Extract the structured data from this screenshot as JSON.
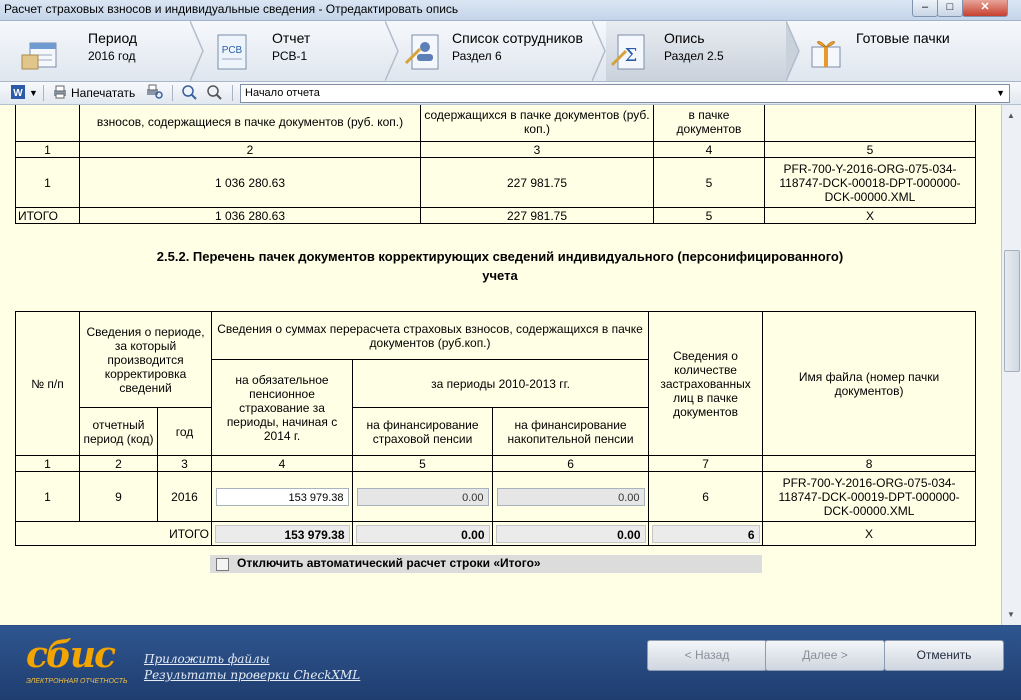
{
  "window": {
    "title": "Расчет страховых взносов и индивидуальные сведения - Отредактировать опись",
    "minimize": "–",
    "maximize": "□",
    "close": "✕"
  },
  "steps": [
    {
      "name": "Период",
      "sub": "2016 год"
    },
    {
      "name": "Отчет",
      "sub": "РСВ-1",
      "icon_text": "РСВ"
    },
    {
      "name": "Список сотрудников",
      "sub": "Раздел 6"
    },
    {
      "name": "Опись",
      "sub": "Раздел 2.5"
    },
    {
      "name": "Готовые пачки",
      "sub": ""
    }
  ],
  "toolbar": {
    "print_label": "Напечатать",
    "section_select": "Начало отчета"
  },
  "table1": {
    "header": {
      "col2": "взносов, содержащиеся в пачке документов (руб. коп.)",
      "col3": "содержащихся в пачке документов (руб. коп.)",
      "col4": "в пачке документов",
      "col5": ""
    },
    "nums": [
      "1",
      "2",
      "3",
      "4",
      "5"
    ],
    "row": {
      "n": "1",
      "c2": "1 036 280.63",
      "c3": "227 981.75",
      "c4": "5",
      "c5": "PFR-700-Y-2016-ORG-075-034-118747-DCK-00018-DPT-000000-DCK-00000.XML"
    },
    "total": {
      "label": "ИТОГО",
      "c2": "1 036 280.63",
      "c3": "227 981.75",
      "c4": "5",
      "c5": "Х"
    }
  },
  "section_title": "2.5.2. Перечень пачек документов корректирующих сведений индивидуального (персонифицированного) учета",
  "table2": {
    "headers": {
      "num": "№ п/п",
      "period": "Сведения о периоде, за который производится корректировка сведений",
      "sums": "Сведения о суммах перерасчета страховых взносов, содержащихся в пачке документов (руб.коп.)",
      "insured": "Сведения о количестве застрахованных лиц в пачке документов",
      "file": "Имя файла (номер пачки документов)",
      "mandatory": "на обязательное пенсионное страхование за периоды, начиная с 2014 г.",
      "periods": "за периоды 2010-2013 гг.",
      "report_period": "отчетный период (код)",
      "year": "год",
      "insurance": "на финансирование страховой пенсии",
      "funded": "на финансирование накопительной пенсии"
    },
    "nums": [
      "1",
      "2",
      "3",
      "4",
      "5",
      "6",
      "7",
      "8"
    ],
    "row": {
      "n": "1",
      "period": "9",
      "year": "2016",
      "c4": "153 979.38",
      "c5": "0.00",
      "c6": "0.00",
      "c7": "6",
      "c8": "PFR-700-Y-2016-ORG-075-034-118747-DCK-00019-DPT-000000-DCK-00000.XML"
    },
    "total": {
      "label": "ИТОГО",
      "c4": "153 979.38",
      "c5": "0.00",
      "c6": "0.00",
      "c7": "6",
      "c8": "Х"
    }
  },
  "option": {
    "label": "Отключить автоматический расчет строки «Итого»",
    "checked": false
  },
  "footer": {
    "logo": "сбис",
    "logo_tagline": "ЭЛЕКТРОННАЯ ОТЧЕТНОСТЬ",
    "link1": "Приложить файлы",
    "link2": "Результаты проверки CheckXML",
    "back": "< Назад",
    "next": "Далее >",
    "cancel": "Отменить"
  },
  "colors": {
    "content_bg": "#ffffe6",
    "footer_bg": "#1f3d6f",
    "logo": "#f2a400"
  }
}
